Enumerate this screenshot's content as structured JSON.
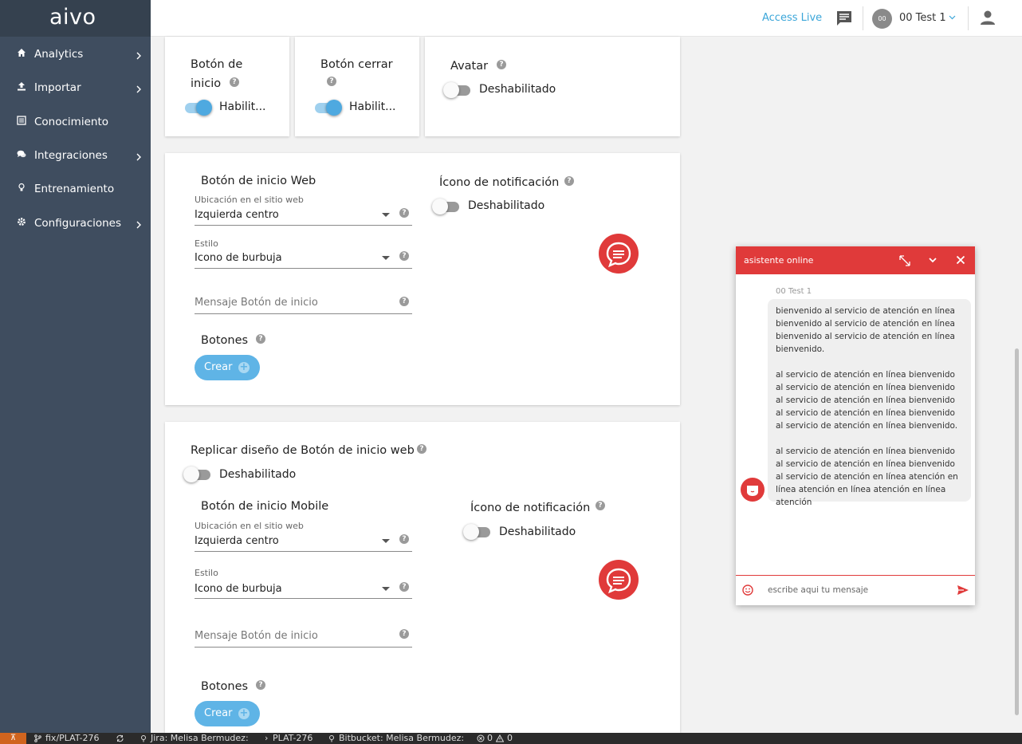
{
  "brand": {
    "logo": "aivo"
  },
  "sidebar": {
    "items": [
      {
        "label": "Analytics",
        "icon": "home-icon",
        "has_children": true
      },
      {
        "label": "Importar",
        "icon": "upload-icon",
        "has_children": true
      },
      {
        "label": "Conocimiento",
        "icon": "list-icon",
        "has_children": false
      },
      {
        "label": "Integraciones",
        "icon": "chat-bubbles-icon",
        "has_children": true
      },
      {
        "label": "Entrenamiento",
        "icon": "lightbulb-icon",
        "has_children": false
      },
      {
        "label": "Configuraciones",
        "icon": "gear-icon",
        "has_children": true
      }
    ]
  },
  "topbar": {
    "access_live": "Access Live",
    "user_initials": "00",
    "user_name": "00 Test 1"
  },
  "top_cards": {
    "inicio": {
      "label_line1": "Botón de",
      "label_line2": "inicio",
      "state": "Habilit...",
      "enabled": true
    },
    "cerrar": {
      "label": "Botón cerrar",
      "state": "Habilit...",
      "enabled": true
    },
    "avatar": {
      "label": "Avatar",
      "state": "Deshabilitado",
      "enabled": false
    }
  },
  "web": {
    "title": "Botón de inicio Web",
    "ubicacion_label": "Ubicación en el sitio web",
    "ubicacion_value": "Izquierda centro",
    "estilo_label": "Estilo",
    "estilo_value": "Icono de burbuja",
    "mensaje_placeholder": "Mensaje Botón de inicio",
    "notif_label": "Ícono de notificación",
    "notif_state": "Deshabilitado",
    "notif_enabled": false,
    "botones_label": "Botones",
    "crear_label": "Crear"
  },
  "mobile": {
    "replicar_label": "Replicar diseño de Botón de inicio web",
    "replicar_state": "Deshabilitado",
    "replicar_enabled": false,
    "title": "Botón de inicio Mobile",
    "ubicacion_label": "Ubicación en el sitio web",
    "ubicacion_value": "Izquierda centro",
    "estilo_label": "Estilo",
    "estilo_value": "Icono de burbuja",
    "mensaje_placeholder": "Mensaje Botón de inicio",
    "notif_label": "Ícono de notificación",
    "notif_state": "Deshabilitado",
    "notif_enabled": false,
    "botones_label": "Botones",
    "crear_label": "Crear"
  },
  "chat_widget": {
    "title": "asistente online",
    "author": "00 Test 1",
    "message_paragraphs": [
      "bienvenido al servicio de atención en línea bienvenido al servicio de atención en línea bienvenido al servicio de atención en línea bienvenido.",
      "al servicio de atención en línea bienvenido al servicio de atención en línea bienvenido al servicio de atención en línea bienvenido al servicio de atención en línea bienvenido al servicio de atención en línea bienvenido.",
      "al servicio de atención en línea bienvenido al servicio de atención en línea bienvenido al servicio de atención en línea atención en línea atención en línea atención en línea atención"
    ],
    "input_placeholder": "escribe aqui tu mensaje"
  },
  "statusbar": {
    "branch": "fix/PLAT-276",
    "jira": "Jira: Melisa Bermudez:",
    "issue": "PLAT-276",
    "bitbucket": "Bitbucket: Melisa Bermudez:",
    "errors": "0",
    "warnings": "0"
  },
  "colors": {
    "sidebar_bg": "#3f4d5f",
    "brand_bg": "#35414f",
    "accent_blue": "#5fb4e6",
    "link_blue": "#3ba6d9",
    "chat_red": "#e03a3a"
  }
}
